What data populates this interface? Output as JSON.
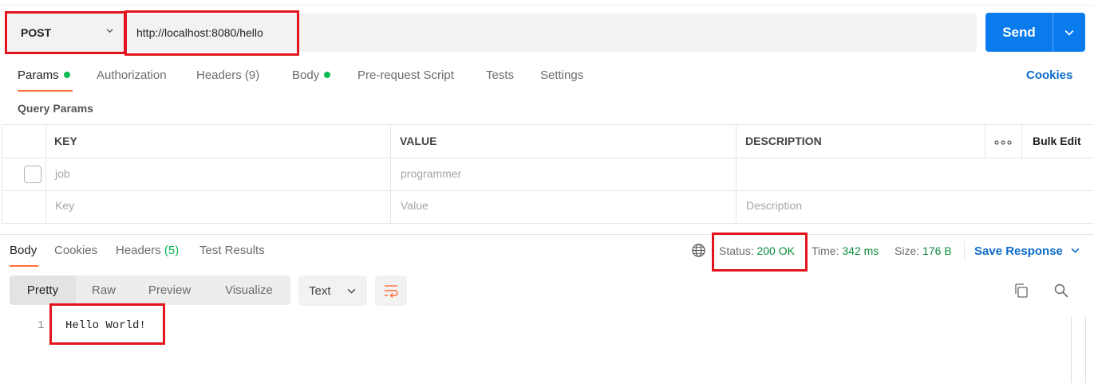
{
  "request": {
    "method": "POST",
    "url": "http://localhost:8080/hello",
    "send_label": "Send"
  },
  "request_tabs": {
    "params": "Params",
    "authorization": "Authorization",
    "headers": "Headers",
    "headers_count": "(9)",
    "body": "Body",
    "pre_request": "Pre-request Script",
    "tests": "Tests",
    "settings": "Settings",
    "cookies": "Cookies"
  },
  "query_params": {
    "section_label": "Query Params",
    "columns": {
      "key": "KEY",
      "value": "VALUE",
      "description": "DESCRIPTION"
    },
    "bulk_edit": "Bulk Edit",
    "rows": [
      {
        "key": "job",
        "value": "programmer",
        "description": ""
      }
    ],
    "placeholder_row": {
      "key": "Key",
      "value": "Value",
      "description": "Description"
    }
  },
  "response": {
    "tabs": {
      "body": "Body",
      "cookies": "Cookies",
      "headers": "Headers",
      "headers_count": "(5)",
      "test_results": "Test Results"
    },
    "status_label": "Status:",
    "status_value": "200 OK",
    "time_label": "Time:",
    "time_value": "342 ms",
    "size_label": "Size:",
    "size_value": "176 B",
    "save_response": "Save Response",
    "view_modes": [
      "Pretty",
      "Raw",
      "Preview",
      "Visualize"
    ],
    "format": "Text",
    "body_lines": [
      {
        "number": "1",
        "text": "Hello World!"
      }
    ]
  },
  "colors": {
    "accent": "#ff6c37",
    "send": "#097bed",
    "link": "#0b6bcb",
    "success": "#0cbb52",
    "highlight": "#e3141d"
  }
}
